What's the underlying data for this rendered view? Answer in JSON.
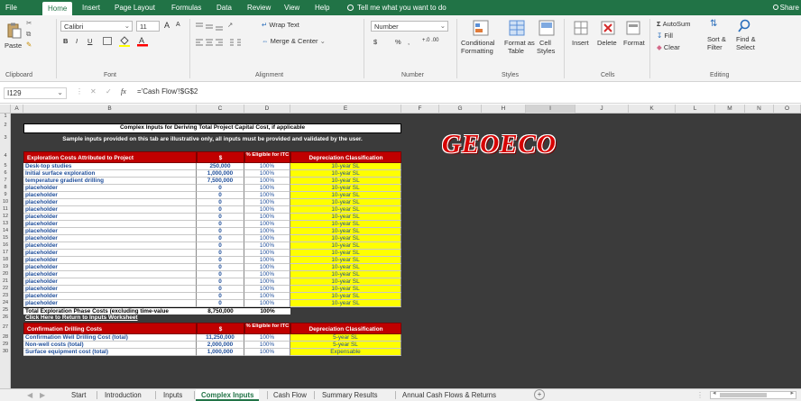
{
  "ribbon_tabs": [
    "File",
    "Home",
    "Insert",
    "Page Layout",
    "Formulas",
    "Data",
    "Review",
    "View",
    "Help"
  ],
  "tell_me": "Tell me what you want to do",
  "share": "Share",
  "clipboard": {
    "paste": "Paste",
    "label": "Clipboard"
  },
  "font": {
    "name": "Calibri",
    "size": "11",
    "grow": "A",
    "shrink": "A",
    "bold": "B",
    "italic": "I",
    "underline": "U",
    "label": "Font"
  },
  "alignment": {
    "wrap_text": "Wrap Text",
    "merge_center": "Merge & Center",
    "label": "Alignment"
  },
  "number": {
    "format": "Number",
    "currency": "$",
    "percent": "%",
    "comma": ",",
    "inc_decimal": "+.0 .00",
    "label": "Number"
  },
  "styles": {
    "conditional": "Conditional",
    "formatting": "Formatting",
    "format_as": "Format as",
    "table": "Table",
    "cell": "Cell",
    "cell_styles": "Styles",
    "label": "Styles"
  },
  "cells": {
    "insert": "Insert",
    "delete": "Delete",
    "format": "Format",
    "label": "Cells"
  },
  "editing": {
    "autosum": "AutoSum",
    "fill": "Fill",
    "clear": "Clear",
    "sort_filter": "Sort &",
    "filter": "Filter",
    "find_select": "Find &",
    "select": "Select",
    "label": "Editing"
  },
  "formula_bar": {
    "name_box": "I129",
    "fx": "fx",
    "formula": "='Cash Flow'!$G$2"
  },
  "columns": [
    "A",
    "B",
    "C",
    "D",
    "E",
    "F",
    "G",
    "H",
    "I",
    "J",
    "K",
    "L",
    "M",
    "N",
    "O"
  ],
  "rows": [
    "1",
    "2",
    "3",
    "4",
    "5",
    "6",
    "7",
    "8",
    "9",
    "10",
    "11",
    "12",
    "13",
    "14",
    "15",
    "16",
    "17",
    "18",
    "19",
    "20",
    "21",
    "22",
    "23",
    "24",
    "25",
    "26",
    "27",
    "28",
    "29",
    "30"
  ],
  "sheet": {
    "title": "Complex Inputs for Deriving Total Project Capital Cost, if applicable",
    "note": "Sample inputs provided on this tab are illustrative only, all inputs must be provided and validated by the user.",
    "logo": "GEOECO",
    "exploration": {
      "headers": [
        "Exploration Costs Attributed to Project",
        "$",
        "% Eligible for ITC",
        "Depreciation Classification"
      ],
      "rows": [
        {
          "label": "Desk-top studies",
          "amount": "250,000",
          "pct": "100%",
          "dep": "10-year SL"
        },
        {
          "label": "Initial surface exploration",
          "amount": "1,000,000",
          "pct": "100%",
          "dep": "10-year SL"
        },
        {
          "label": "temperature gradient drilling",
          "amount": "7,500,000",
          "pct": "100%",
          "dep": "10-year SL"
        },
        {
          "label": "placeholder",
          "amount": "0",
          "pct": "100%",
          "dep": "10-year SL"
        },
        {
          "label": "placeholder",
          "amount": "0",
          "pct": "100%",
          "dep": "10-year SL"
        },
        {
          "label": "placeholder",
          "amount": "0",
          "pct": "100%",
          "dep": "10-year SL"
        },
        {
          "label": "placeholder",
          "amount": "0",
          "pct": "100%",
          "dep": "10-year SL"
        },
        {
          "label": "placeholder",
          "amount": "0",
          "pct": "100%",
          "dep": "10-year SL"
        },
        {
          "label": "placeholder",
          "amount": "0",
          "pct": "100%",
          "dep": "10-year SL"
        },
        {
          "label": "placeholder",
          "amount": "0",
          "pct": "100%",
          "dep": "10-year SL"
        },
        {
          "label": "placeholder",
          "amount": "0",
          "pct": "100%",
          "dep": "10-year SL"
        },
        {
          "label": "placeholder",
          "amount": "0",
          "pct": "100%",
          "dep": "10-year SL"
        },
        {
          "label": "placeholder",
          "amount": "0",
          "pct": "100%",
          "dep": "10-year SL"
        },
        {
          "label": "placeholder",
          "amount": "0",
          "pct": "100%",
          "dep": "10-year SL"
        },
        {
          "label": "placeholder",
          "amount": "0",
          "pct": "100%",
          "dep": "10-year SL"
        },
        {
          "label": "placeholder",
          "amount": "0",
          "pct": "100%",
          "dep": "10-year SL"
        },
        {
          "label": "placeholder",
          "amount": "0",
          "pct": "100%",
          "dep": "10-year SL"
        },
        {
          "label": "placeholder",
          "amount": "0",
          "pct": "100%",
          "dep": "10-year SL"
        },
        {
          "label": "placeholder",
          "amount": "0",
          "pct": "100%",
          "dep": "10-year SL"
        },
        {
          "label": "placeholder",
          "amount": "0",
          "pct": "100%",
          "dep": "10-year SL"
        }
      ],
      "total_label": "Total Exploration Phase Costs (excluding time-value",
      "total_amount": "8,750,000",
      "total_pct": "100%"
    },
    "return_link": "Click Here to Return to Inputs Worksheet",
    "confirmation": {
      "headers": [
        "Confirmation Drilling Costs",
        "$",
        "% Eligible for ITC",
        "Depreciation Classification"
      ],
      "rows": [
        {
          "label": "Confirmation Well Drilling Cost (total)",
          "amount": "11,250,000",
          "pct": "100%",
          "dep": "5-year SL"
        },
        {
          "label": "Non-well costs (total)",
          "amount": "2,000,000",
          "pct": "100%",
          "dep": "5-year SL"
        },
        {
          "label": "Surface equipment cost (total)",
          "amount": "1,000,000",
          "pct": "100%",
          "dep": "Expensable"
        }
      ]
    }
  },
  "sheet_tabs": [
    "Start",
    "Introduction",
    "Inputs",
    "Complex Inputs",
    "Cash Flow",
    "Summary Results",
    "Annual Cash Flows & Returns"
  ],
  "active_sheet": "Complex Inputs",
  "colors": {
    "ribbon_green": "#217346",
    "header_red": "#c00000",
    "dep_yellow": "#ffff00",
    "value_blue": "#1f4e9a",
    "sheet_bg": "#3b3b3b"
  }
}
